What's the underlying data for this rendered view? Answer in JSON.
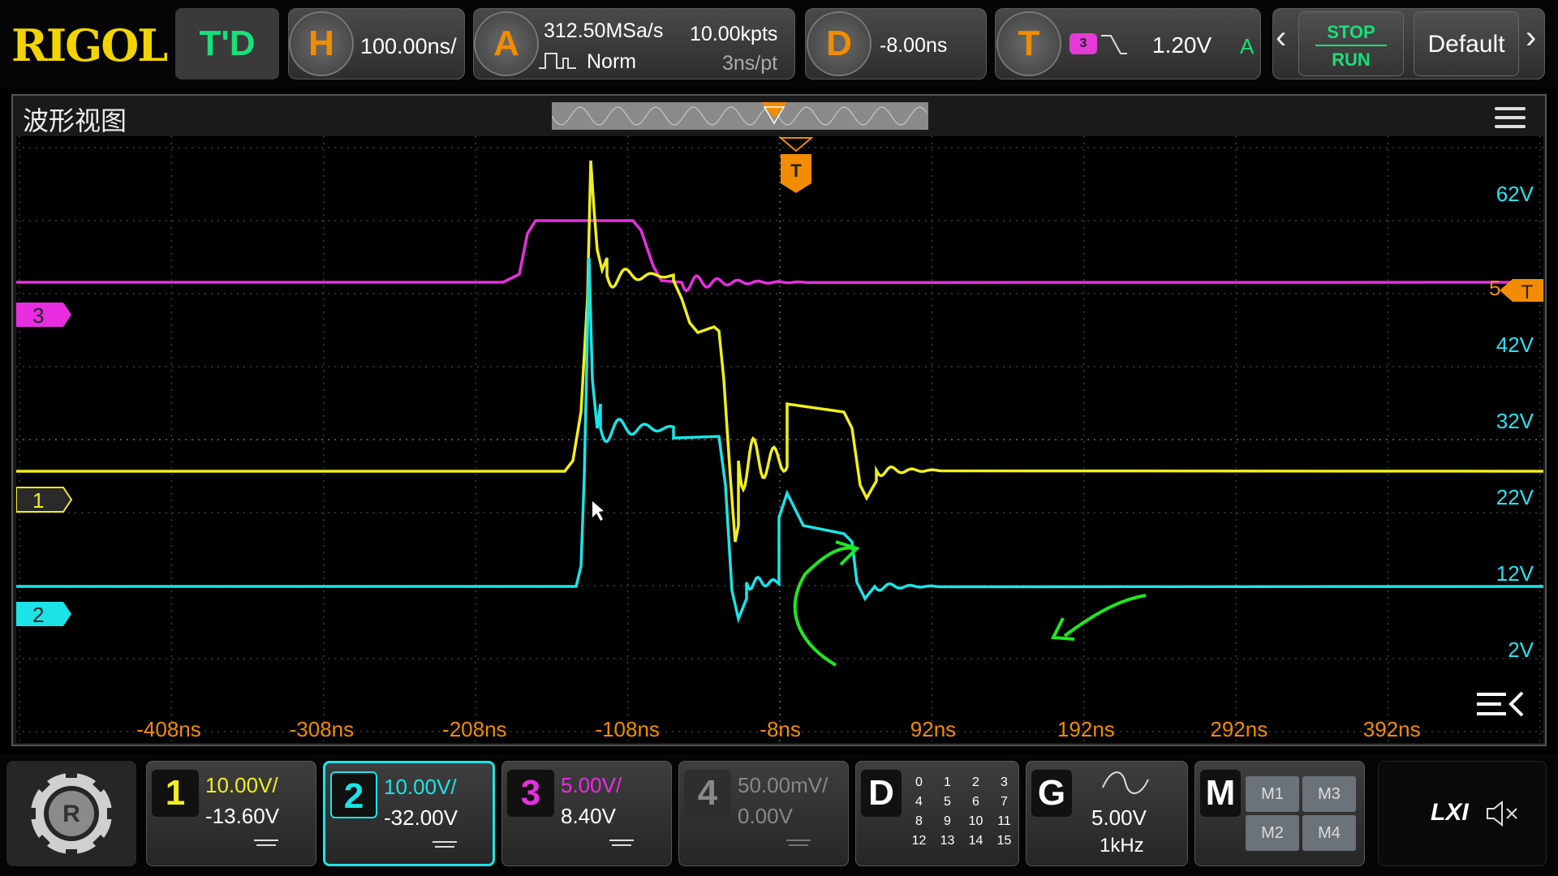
{
  "topbar": {
    "logo": "RIGOL",
    "td_label": "T'D",
    "horizontal": {
      "label": "H",
      "scale": "100.00ns/"
    },
    "acquire": {
      "label": "A",
      "sample_rate": "312.50MSa/s",
      "memory": "10.00kpts",
      "mode": "Norm",
      "time_per_pt": "3ns/pt"
    },
    "delay": {
      "label": "D",
      "value": "-8.00ns"
    },
    "trigger": {
      "label": "T",
      "source": "3",
      "level": "1.20V",
      "mode": "A"
    },
    "stop_label": "STOP",
    "run_label": "RUN",
    "default_label": "Default"
  },
  "waveview": {
    "title": "波形视图",
    "trigger_marker": "T",
    "ch3_marker": "3",
    "ch1_marker": "1",
    "ch2_marker": "2",
    "trig_level_marker": "T",
    "trig_level_prefix": "5",
    "y_labels": [
      "62V",
      "42V",
      "32V",
      "22V",
      "12V",
      "2V"
    ],
    "x_labels": [
      "-408ns",
      "-308ns",
      "-208ns",
      "-108ns",
      "-8ns",
      "92ns",
      "192ns",
      "292ns",
      "392ns"
    ]
  },
  "colors": {
    "ch1": "#f0ef1e",
    "ch2": "#1ae4e8",
    "ch3": "#e82ee0",
    "orange": "#f28c00",
    "annot": "#1ee81e",
    "axis_label": "#24e4f4"
  },
  "channels": [
    {
      "num": "1",
      "scale": "10.00V/",
      "offset": "-13.60V"
    },
    {
      "num": "2",
      "scale": "10.00V/",
      "offset": "-32.00V"
    },
    {
      "num": "3",
      "scale": "5.00V/",
      "offset": "8.40V"
    },
    {
      "num": "4",
      "scale": "50.00mV/",
      "offset": "0.00V"
    }
  ],
  "digital": {
    "label": "D",
    "rows": [
      [
        "0",
        "1",
        "2",
        "3"
      ],
      [
        "4",
        "5",
        "6",
        "7"
      ],
      [
        "8",
        "9",
        "10",
        "11"
      ],
      [
        "12",
        "13",
        "14",
        "15"
      ]
    ]
  },
  "generator": {
    "label": "G",
    "amplitude": "5.00V",
    "frequency": "1kHz"
  },
  "math": {
    "label": "M",
    "buttons": [
      "M1",
      "M3",
      "M2",
      "M4"
    ]
  },
  "status": {
    "lxi": "LXI"
  }
}
